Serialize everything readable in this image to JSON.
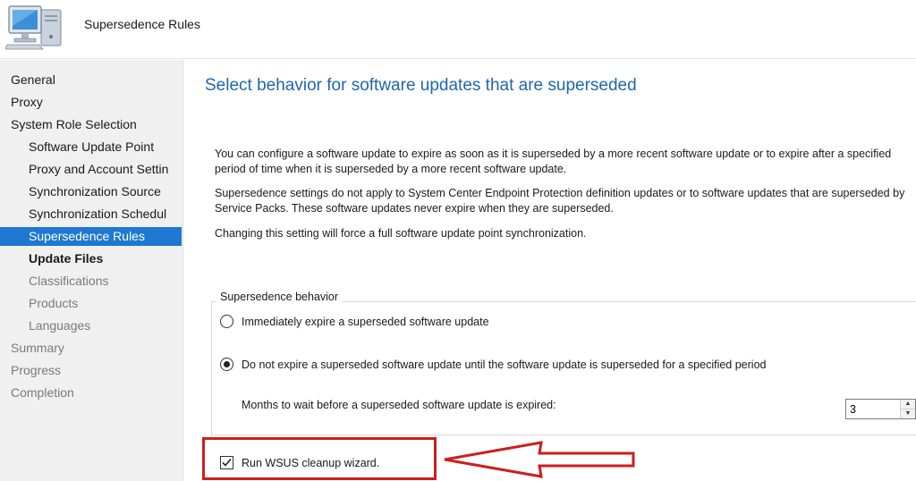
{
  "header": {
    "title": "Supersedence Rules",
    "icon": "computer-wizard-icon"
  },
  "sidebar": {
    "items": [
      {
        "label": "General",
        "level": 0,
        "state": "done"
      },
      {
        "label": "Proxy",
        "level": 0,
        "state": "done"
      },
      {
        "label": "System Role Selection",
        "level": 0,
        "state": "done"
      },
      {
        "label": "Software Update Point",
        "level": 1,
        "state": "done"
      },
      {
        "label": "Proxy and Account Settin",
        "level": 1,
        "state": "done"
      },
      {
        "label": "Synchronization Source",
        "level": 1,
        "state": "done"
      },
      {
        "label": "Synchronization Schedul",
        "level": 1,
        "state": "done"
      },
      {
        "label": "Supersedence Rules",
        "level": 1,
        "state": "selected"
      },
      {
        "label": "Update Files",
        "level": 1,
        "state": "next"
      },
      {
        "label": "Classifications",
        "level": 1,
        "state": "future"
      },
      {
        "label": "Products",
        "level": 1,
        "state": "future"
      },
      {
        "label": "Languages",
        "level": 1,
        "state": "future"
      },
      {
        "label": "Summary",
        "level": 0,
        "state": "future"
      },
      {
        "label": "Progress",
        "level": 0,
        "state": "future"
      },
      {
        "label": "Completion",
        "level": 0,
        "state": "future"
      }
    ]
  },
  "main": {
    "title": "Select behavior for software updates that are superseded",
    "desc1": "You can configure a software update to expire as soon as it is superseded by a more recent software update or to expire after a specified period of time when it is superseded by a more recent software update.",
    "desc2": "Supersedence settings do not apply to System Center Endpoint Protection definition updates or to software updates that are superseded by Service Packs. These software updates never expire when they are superseded.",
    "desc3": "Changing this setting will force a full software update point synchronization.",
    "group_label": "Supersedence behavior",
    "option_immediate": "Immediately expire a superseded software update",
    "option_wait": "Do not expire a superseded software update until the software update is superseded for a specified period",
    "selected_option": "wait",
    "months_label": "Months to wait before a superseded software update is expired:",
    "months_value": "3",
    "cleanup_label": "Run WSUS cleanup wizard.",
    "cleanup_checked": true
  },
  "annotation": {
    "color": "#cc1e1e"
  },
  "colors": {
    "title_blue": "#1f66ad",
    "selection_blue": "#1e78d2",
    "sidebar_bg": "#f0f0f0"
  }
}
